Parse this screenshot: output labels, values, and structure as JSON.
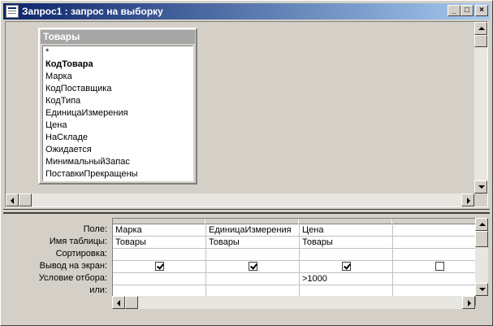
{
  "window": {
    "title": "Запрос1 : запрос на выборку",
    "buttons": {
      "minimize": "_",
      "maximize": "□",
      "close": "×"
    }
  },
  "table": {
    "name": "Товары",
    "fields": [
      {
        "label": "*",
        "key": false
      },
      {
        "label": "КодТовара",
        "key": true
      },
      {
        "label": "Марка",
        "key": false
      },
      {
        "label": "КодПоставщика",
        "key": false
      },
      {
        "label": "КодТипа",
        "key": false
      },
      {
        "label": "ЕдиницаИзмерения",
        "key": false
      },
      {
        "label": "Цена",
        "key": false
      },
      {
        "label": "НаСкладе",
        "key": false
      },
      {
        "label": "Ожидается",
        "key": false
      },
      {
        "label": "МинимальныйЗапас",
        "key": false
      },
      {
        "label": "ПоставкиПрекращены",
        "key": false
      }
    ]
  },
  "grid": {
    "row_labels": [
      "Поле:",
      "Имя таблицы:",
      "Сортировка:",
      "Вывод на экран:",
      "Условие отбора:",
      "или:"
    ],
    "columns": [
      {
        "field": "Марка",
        "table": "Товары",
        "sort": "",
        "show": true,
        "criteria": "",
        "or": ""
      },
      {
        "field": "ЕдиницаИзмерения",
        "table": "Товары",
        "sort": "",
        "show": true,
        "criteria": "",
        "or": ""
      },
      {
        "field": "Цена",
        "table": "Товары",
        "sort": "",
        "show": true,
        "criteria": ">1000",
        "or": ""
      },
      {
        "field": "",
        "table": "",
        "sort": "",
        "show": false,
        "criteria": "",
        "or": ""
      }
    ]
  },
  "colors": {
    "titlebar_start": "#0a246a",
    "titlebar_end": "#a6caf0",
    "face": "#d4d0c8"
  }
}
